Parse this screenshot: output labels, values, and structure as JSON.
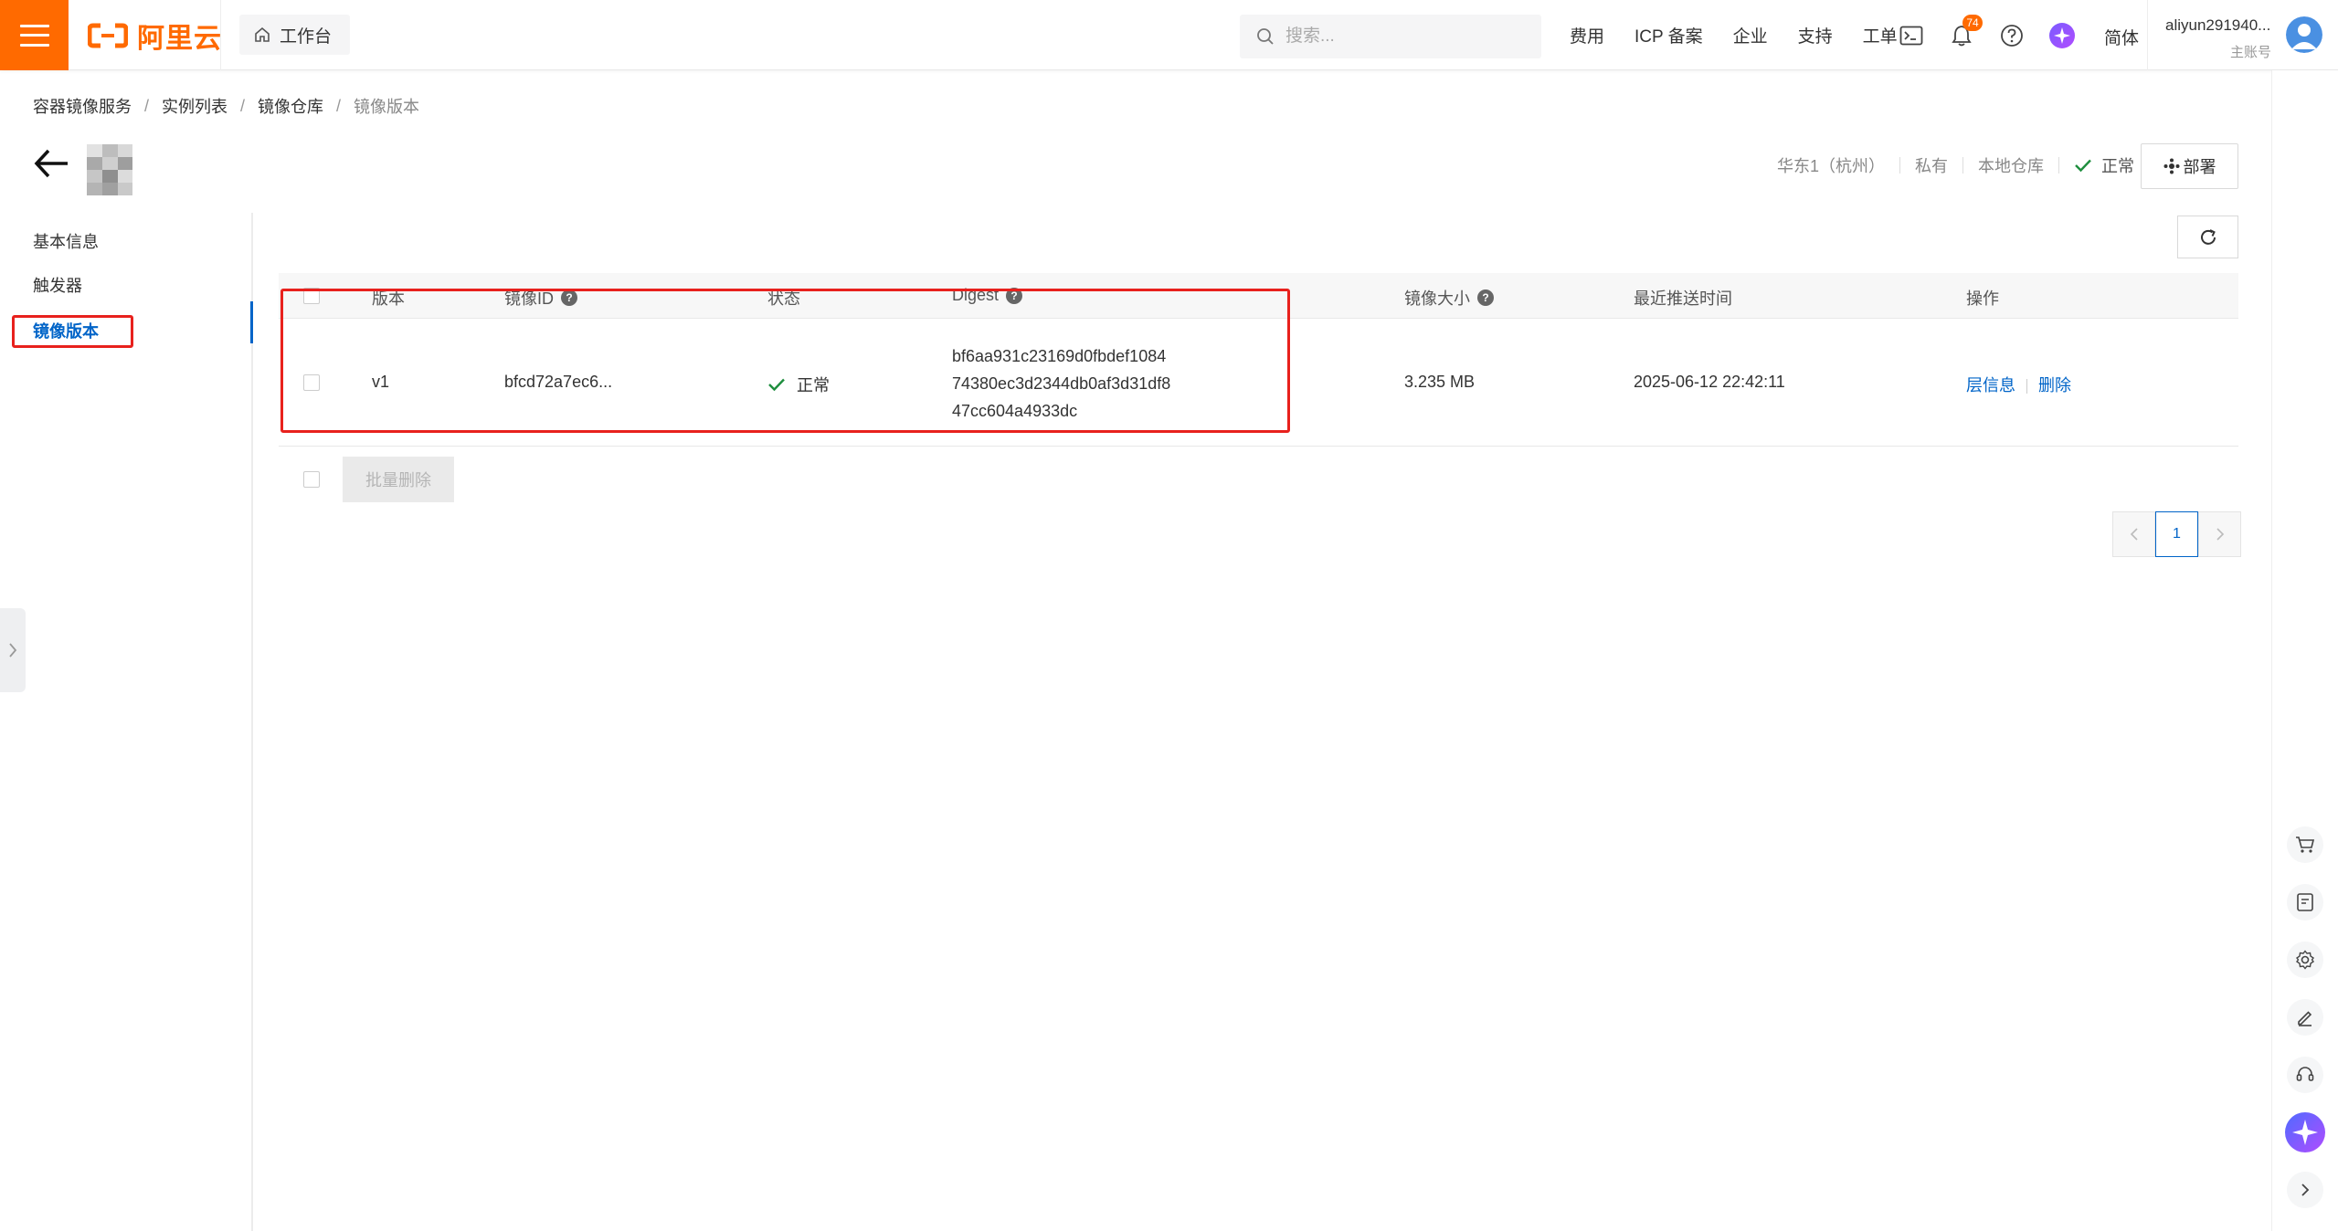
{
  "brand": {
    "logo_text": "阿里云",
    "accent": "#ff6a00"
  },
  "topbar": {
    "workbench_label": "工作台",
    "search_placeholder": "搜索...",
    "links": [
      "费用",
      "ICP 备案",
      "企业",
      "支持",
      "工单"
    ],
    "notification_count": "74",
    "language": "简体",
    "user_name": "aliyun291940...",
    "user_role": "主账号"
  },
  "breadcrumb": [
    "容器镜像服务",
    "实例列表",
    "镜像仓库",
    "镜像版本"
  ],
  "header": {
    "region": "华东1（杭州）",
    "visibility": "私有",
    "repo_type": "本地仓库",
    "status": "正常",
    "deploy_label": "部署"
  },
  "subnav": {
    "items": [
      "基本信息",
      "触发器",
      "镜像版本"
    ],
    "active_index": 2,
    "active_color": "#0064c8"
  },
  "table": {
    "columns": {
      "version": "版本",
      "image_id": "镜像ID",
      "status": "状态",
      "digest": "Digest",
      "size": "镜像大小",
      "pushed": "最近推送时间",
      "ops": "操作"
    },
    "rows": [
      {
        "version": "v1",
        "image_id": "bfcd72a7ec6...",
        "status": "正常",
        "digest_lines": [
          "bf6aa931c23169d0fbdef1084",
          "74380ec3d2344db0af3d31df8",
          "47cc604a4933dc"
        ],
        "size": "3.235 MB",
        "pushed": "2025-06-12 22:42:11",
        "op_layers": "层信息",
        "op_delete": "删除"
      }
    ],
    "batch_delete_label": "批量删除"
  },
  "pagination": {
    "current": "1"
  },
  "highlight_color": "#e8211d",
  "icons": [
    "menu-icon",
    "home-icon",
    "search-icon",
    "terminal-icon",
    "bell-icon",
    "help-icon",
    "ai-assistant-icon",
    "refresh-icon",
    "check-icon",
    "cart-icon",
    "settings-icon",
    "edit-icon",
    "support-icon",
    "chevron-right-icon"
  ]
}
